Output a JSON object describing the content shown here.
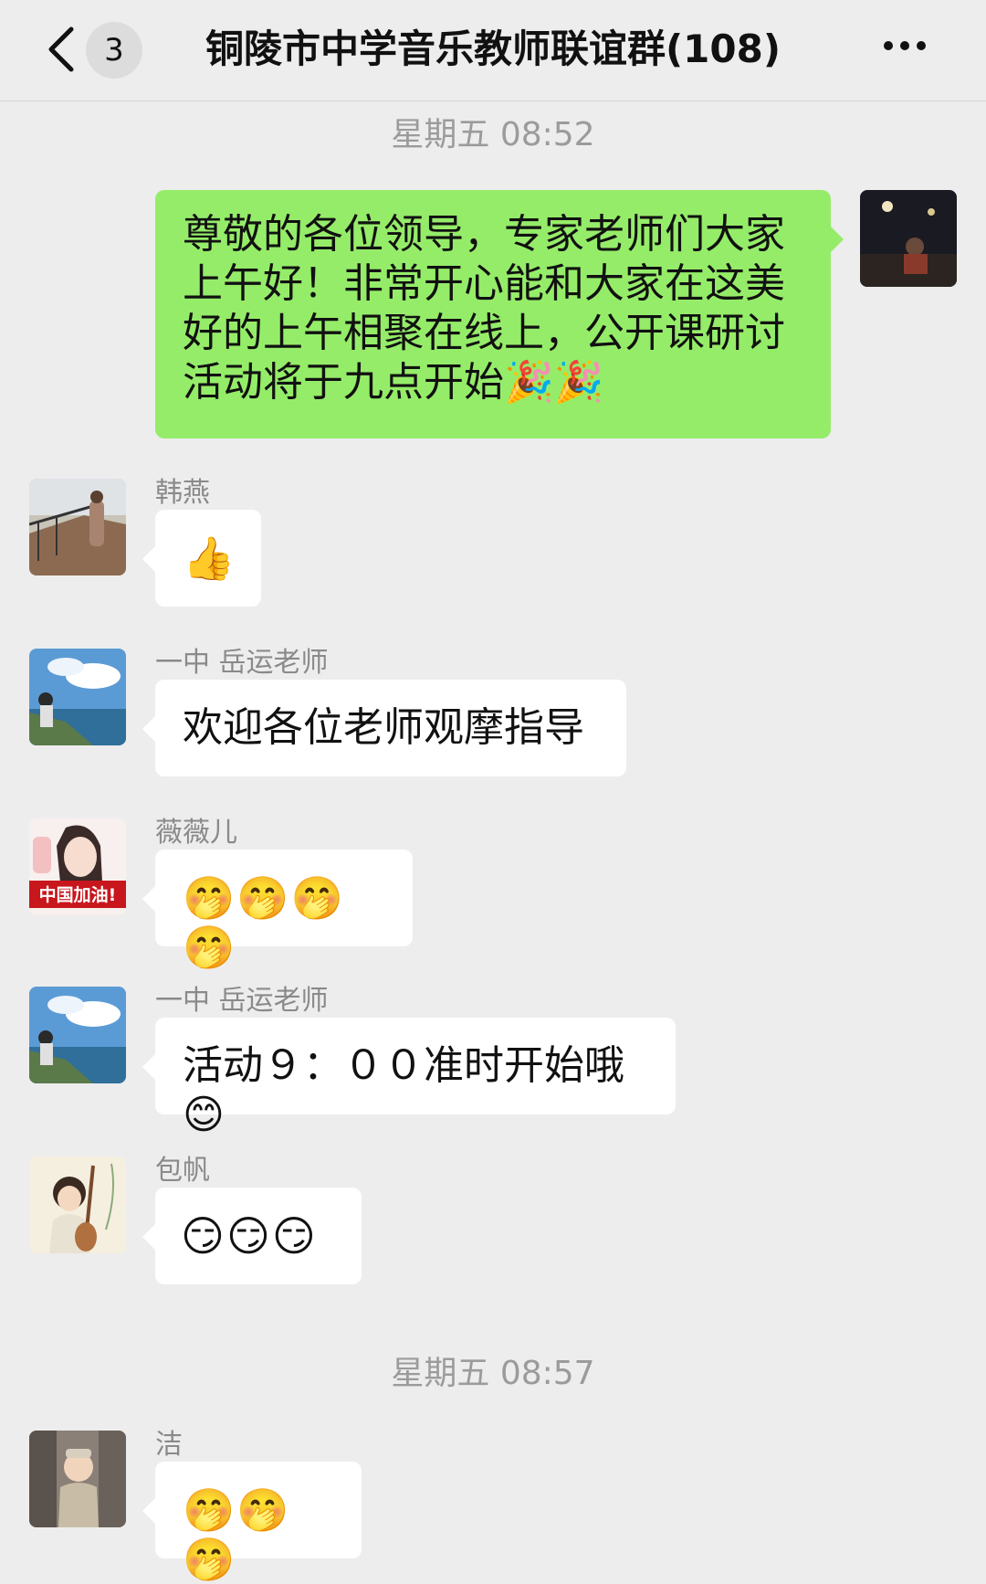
{
  "header": {
    "back_icon": "chevron-left-icon",
    "unread_count": "3",
    "title": "铜陵市中学音乐教师联谊群(108)",
    "more_icon": "more-dots-icon"
  },
  "timestamps": [
    "星期五 08:52",
    "星期五 08:57"
  ],
  "messages": [
    {
      "sender": "",
      "text": "尊敬的各位领导，专家老师们大家上午好！非常开心能和大家在这美好的上午相聚在线上，公开课研讨活动将于九点开始🎉🎉",
      "self": true
    },
    {
      "sender": "韩燕",
      "text": "👍"
    },
    {
      "sender": "一中 岳运老师",
      "text": "欢迎各位老师观摩指导"
    },
    {
      "sender": "薇薇儿",
      "text": "🤭🤭🤭🤭"
    },
    {
      "sender": "一中 岳运老师",
      "text": "活动９：００准时开始哦😊"
    },
    {
      "sender": "包帆",
      "text": "😏😏😏"
    },
    {
      "sender": "洁",
      "text": "🤭🤭🤭"
    }
  ],
  "avatar_badge_text": "中国加油!"
}
